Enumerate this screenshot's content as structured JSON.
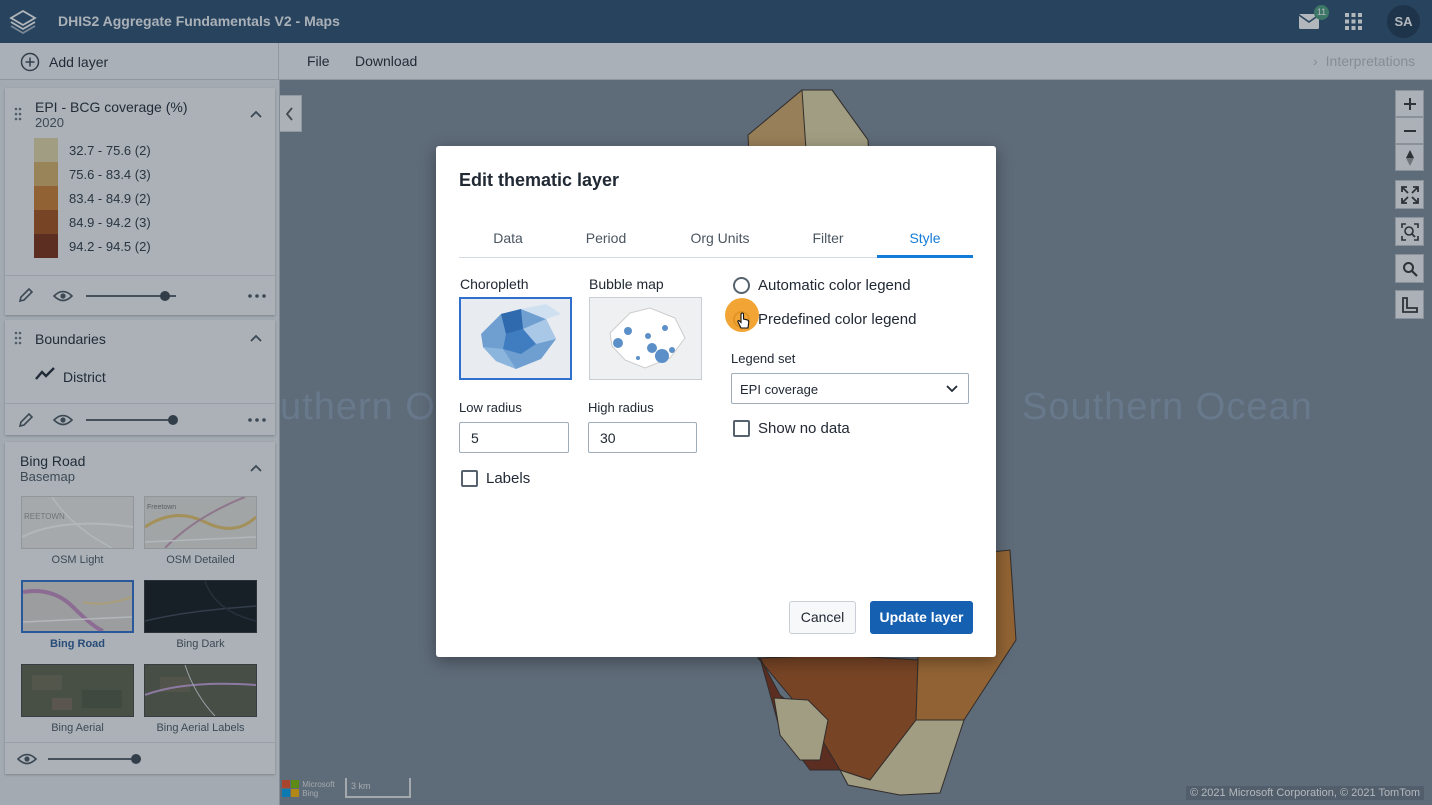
{
  "header": {
    "app_title": "DHIS2 Aggregate Fundamentals V2 - Maps",
    "mail_badge": "11",
    "avatar": "SA"
  },
  "toolbar": {
    "add_layer": "Add layer",
    "file": "File",
    "download": "Download",
    "interpretations": "Interpretations"
  },
  "layers": {
    "thematic": {
      "title": "EPI - BCG coverage (%)",
      "period": "2020",
      "legend": [
        {
          "label": "32.7 - 75.6 (2)",
          "color": "#e4d7a7"
        },
        {
          "label": "75.6 - 83.4 (3)",
          "color": "#d9b068"
        },
        {
          "label": "83.4 - 84.9 (2)",
          "color": "#cc7f2e"
        },
        {
          "label": "84.9 - 94.2 (3)",
          "color": "#a54f1a"
        },
        {
          "label": "94.2 - 94.5 (2)",
          "color": "#7b2d11"
        }
      ],
      "opacity": 0.85
    },
    "boundaries": {
      "title": "Boundaries",
      "item": "District",
      "opacity": 0.9
    },
    "basemap": {
      "title": "Bing Road",
      "subtitle": "Basemap",
      "options": [
        {
          "label": "OSM Light",
          "selected": false
        },
        {
          "label": "OSM Detailed",
          "selected": false
        },
        {
          "label": "Bing Road",
          "selected": true
        },
        {
          "label": "Bing Dark",
          "selected": false
        },
        {
          "label": "Bing Aerial",
          "selected": false
        },
        {
          "label": "Bing Aerial Labels",
          "selected": false
        }
      ],
      "opacity": 1.0
    }
  },
  "map": {
    "ocean_left": "uthern O",
    "ocean_right": "Southern Ocean",
    "scale": "3 km",
    "logo": "Microsoft Bing",
    "attribution": "© 2021 Microsoft Corporation, © 2021 TomTom"
  },
  "dialog": {
    "title": "Edit thematic layer",
    "tabs": [
      "Data",
      "Period",
      "Org Units",
      "Filter",
      "Style"
    ],
    "active_tab": "Style",
    "choropleth_label": "Choropleth",
    "bubble_label": "Bubble map",
    "low_radius_label": "Low radius",
    "low_radius_value": "5",
    "high_radius_label": "High radius",
    "high_radius_value": "30",
    "labels_label": "Labels",
    "auto_legend_label": "Automatic color legend",
    "predefined_legend_label": "Predefined color legend",
    "legend_set_label": "Legend set",
    "legend_set_value": "EPI coverage",
    "show_no_data_label": "Show no data",
    "cancel": "Cancel",
    "update": "Update layer"
  }
}
